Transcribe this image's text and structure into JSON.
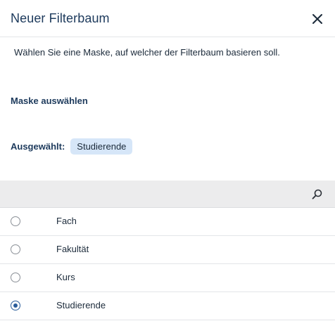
{
  "dialog": {
    "title": "Neuer Filterbaum",
    "intro": "Wählen Sie eine Maske, auf welcher der Filterbaum basieren soll.",
    "section_title": "Maske auswählen",
    "selected_label": "Ausgewählt:",
    "selected_value": "Studierende"
  },
  "icons": {
    "close": "close-icon",
    "search": "search-icon"
  },
  "list": {
    "items": [
      {
        "label": "Fach",
        "checked": false
      },
      {
        "label": "Fakultät",
        "checked": false
      },
      {
        "label": "Kurs",
        "checked": false
      },
      {
        "label": "Studierende",
        "checked": true
      }
    ]
  },
  "colors": {
    "title": "#1d3a5c",
    "chip_background": "#d6e6f8",
    "search_bar": "#ececed",
    "radio_checked": "#2a5c9a"
  }
}
